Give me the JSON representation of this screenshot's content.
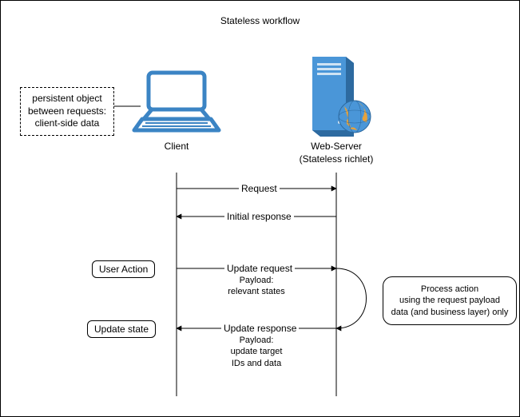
{
  "title": "Stateless workflow",
  "client": {
    "label": "Client"
  },
  "server": {
    "label": "Web-Server",
    "sub": "(Stateless richlet)"
  },
  "note": {
    "l1": "persistent object",
    "l2": "between requests:",
    "l3": "client-side data"
  },
  "msg": {
    "request": "Request",
    "initial_response": "Initial response",
    "update_request": "Update request",
    "update_response": "Update response"
  },
  "user_action": "User Action",
  "update_state": "Update state",
  "process": {
    "l1": "Process action",
    "l2": "using the request payload",
    "l3": "data (and business layer) only"
  },
  "payload1": {
    "l1": "Payload:",
    "l2": "relevant states"
  },
  "payload2": {
    "l1": "Payload:",
    "l2": "update target",
    "l3": "IDs and data"
  }
}
